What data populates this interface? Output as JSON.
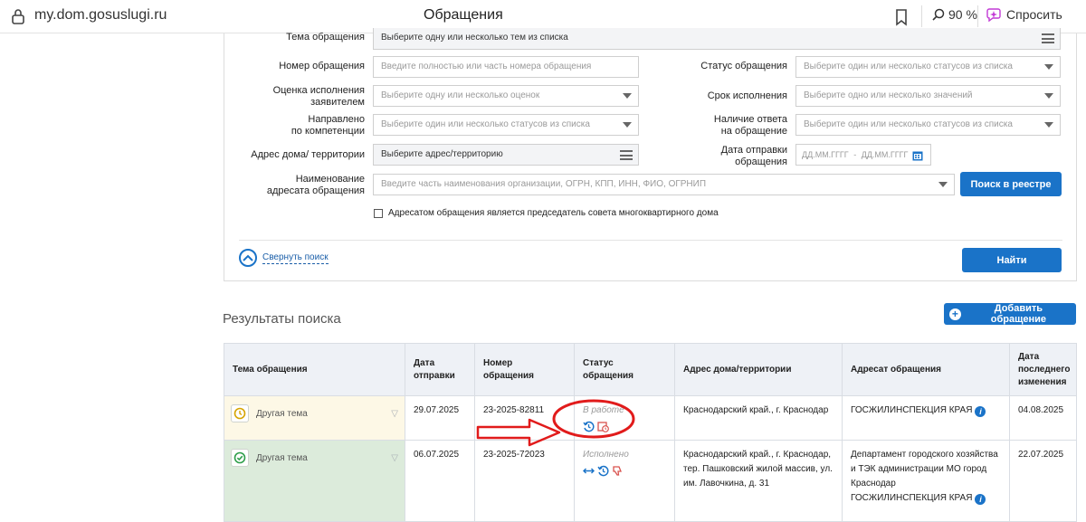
{
  "browser": {
    "url": "my.dom.gosuslugi.ru",
    "page_title": "Обращения",
    "zoom": "90 %",
    "ask_label": "Спросить"
  },
  "form": {
    "topic_label": "Тема обращения",
    "topic_value": "Выберите одну или несколько тем из списка",
    "number_label": "Номер обращения",
    "number_placeholder": "Введите полностью или часть номера обращения",
    "status_label": "Статус обращения",
    "status_placeholder": "Выберите один или несколько статусов из списка",
    "rating_label_1": "Оценка исполнения",
    "rating_label_2": "заявителем",
    "rating_placeholder": "Выберите одну или несколько оценок",
    "deadline_label": "Срок исполнения",
    "deadline_placeholder": "Выберите одно или несколько значений",
    "redirected_label_1": "Направлено",
    "redirected_label_2": "по компетенции",
    "redirected_placeholder": "Выберите один или несколько статусов из списка",
    "answer_label_1": "Наличие ответа",
    "answer_label_2": "на обращение",
    "answer_placeholder": "Выберите один или несколько статусов из списка",
    "address_label": "Адрес дома/ территории",
    "address_value": "Выберите адрес/территорию",
    "sent_date_label_1": "Дата отправки",
    "sent_date_label_2": "обращения",
    "date_from_placeholder": "ДД.ММ.ГГГГ",
    "date_sep": "-",
    "date_to_placeholder": "ДД.ММ.ГГГГ",
    "addressee_label_1": "Наименование",
    "addressee_label_2": "адресата обращения",
    "addressee_placeholder": "Введите часть наименования организации, ОГРН, КПП, ИНН, ФИО, ОГРНИП",
    "registry_search_button": "Поиск в реестре",
    "chairman_checkbox_label": "Адресатом обращения является председатель совета многоквартирного дома",
    "collapse_label": "Свернуть поиск",
    "find_button": "Найти"
  },
  "results": {
    "title": "Результаты поиска",
    "add_button": "Добавить обращение",
    "columns": [
      "Тема обращения",
      "Дата отправки",
      "Номер обращения",
      "Статус обращения",
      "Адрес дома/территории",
      "Адресат обращения",
      "Дата последнего изменения"
    ],
    "rows": [
      {
        "topic": "Другая тема",
        "sent_date": "29.07.2025",
        "number": "23-2025-82811",
        "status": "В работе",
        "address": "Краснодарский край., г. Краснодар",
        "addressee": "ГОСЖИЛИНСПЕКЦИЯ КРАЯ",
        "changed": "04.08.2025"
      },
      {
        "topic": "Другая тема",
        "sent_date": "06.07.2025",
        "number": "23-2025-72023",
        "status": "Исполнено",
        "address": "Краснодарский край., г. Краснодар, тер. Пашковский жилой массив, ул. им. Лавочкина, д. 31",
        "addressee": "Департамент городского хозяйства и ТЭК администрации МО город Краснодар",
        "addressee_2": "ГОСЖИЛИНСПЕКЦИЯ КРАЯ",
        "changed": "22.07.2025"
      }
    ]
  },
  "colors": {
    "primary": "#1a73c8",
    "annotation_red": "#e11b1b",
    "row_in_work": "#fdf8e6",
    "row_done": "#dcebdb"
  },
  "icons": {
    "lock": "lock-icon",
    "bookmark": "bookmark-icon",
    "zoom": "zoom-icon",
    "ask": "ask-ai-icon",
    "clock": "clock-icon",
    "check": "check-circle-icon",
    "history": "history-icon",
    "deadline": "calendar-clock-icon",
    "redirect": "arrows-horizontal-icon",
    "rating_down": "thumbs-down-icon",
    "info": "info-icon"
  }
}
